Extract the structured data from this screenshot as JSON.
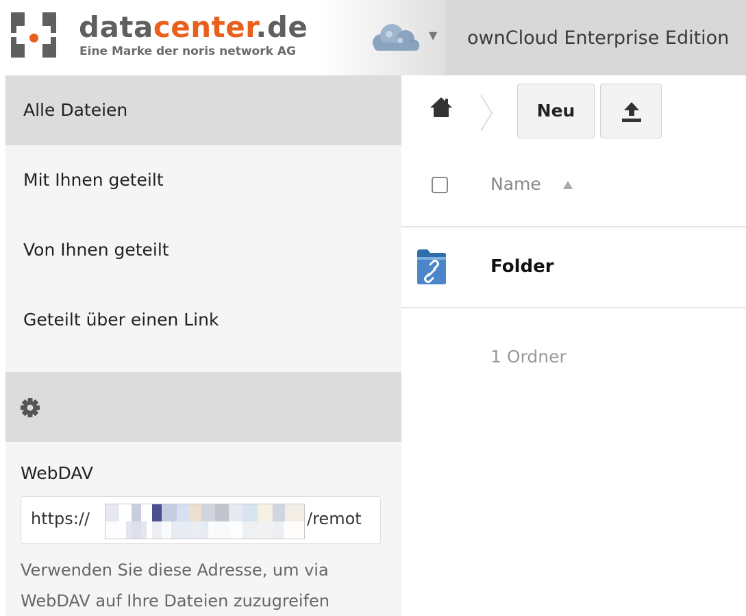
{
  "header": {
    "brand_prefix": "data",
    "brand_accent": "center",
    "brand_suffix": ".de",
    "tagline": "Eine Marke der noris network AG",
    "app_menu_icon": "cloud-icon",
    "title": "ownCloud Enterprise Edition"
  },
  "colors": {
    "brand_orange": "#e8601c",
    "brand_gray": "#5f5f5f",
    "folder_blue": "#4a86c8",
    "sidebar_bg": "#f5f5f5",
    "sidebar_active": "#dcdcdc"
  },
  "sidebar": {
    "items": [
      {
        "label": "Alle Dateien",
        "active": true
      },
      {
        "label": "Mit Ihnen geteilt",
        "active": false
      },
      {
        "label": "Von Ihnen geteilt",
        "active": false
      },
      {
        "label": "Geteilt über einen Link",
        "active": false
      }
    ],
    "settings_icon": "gear-icon",
    "webdav": {
      "label": "WebDAV",
      "url_prefix": "https://",
      "url_suffix": "/remot",
      "help": "Verwenden Sie diese Adresse, um via WebDAV auf Ihre Dateien zuzugreifen"
    }
  },
  "toolbar": {
    "home_icon": "home-icon",
    "new_label": "Neu",
    "upload_icon": "upload-icon"
  },
  "files": {
    "header": {
      "name": "Name",
      "sort_icon": "sort-ascending-icon"
    },
    "rows": [
      {
        "name": "Folder",
        "type": "shared-link-folder"
      }
    ],
    "summary": "1 Ordner"
  }
}
